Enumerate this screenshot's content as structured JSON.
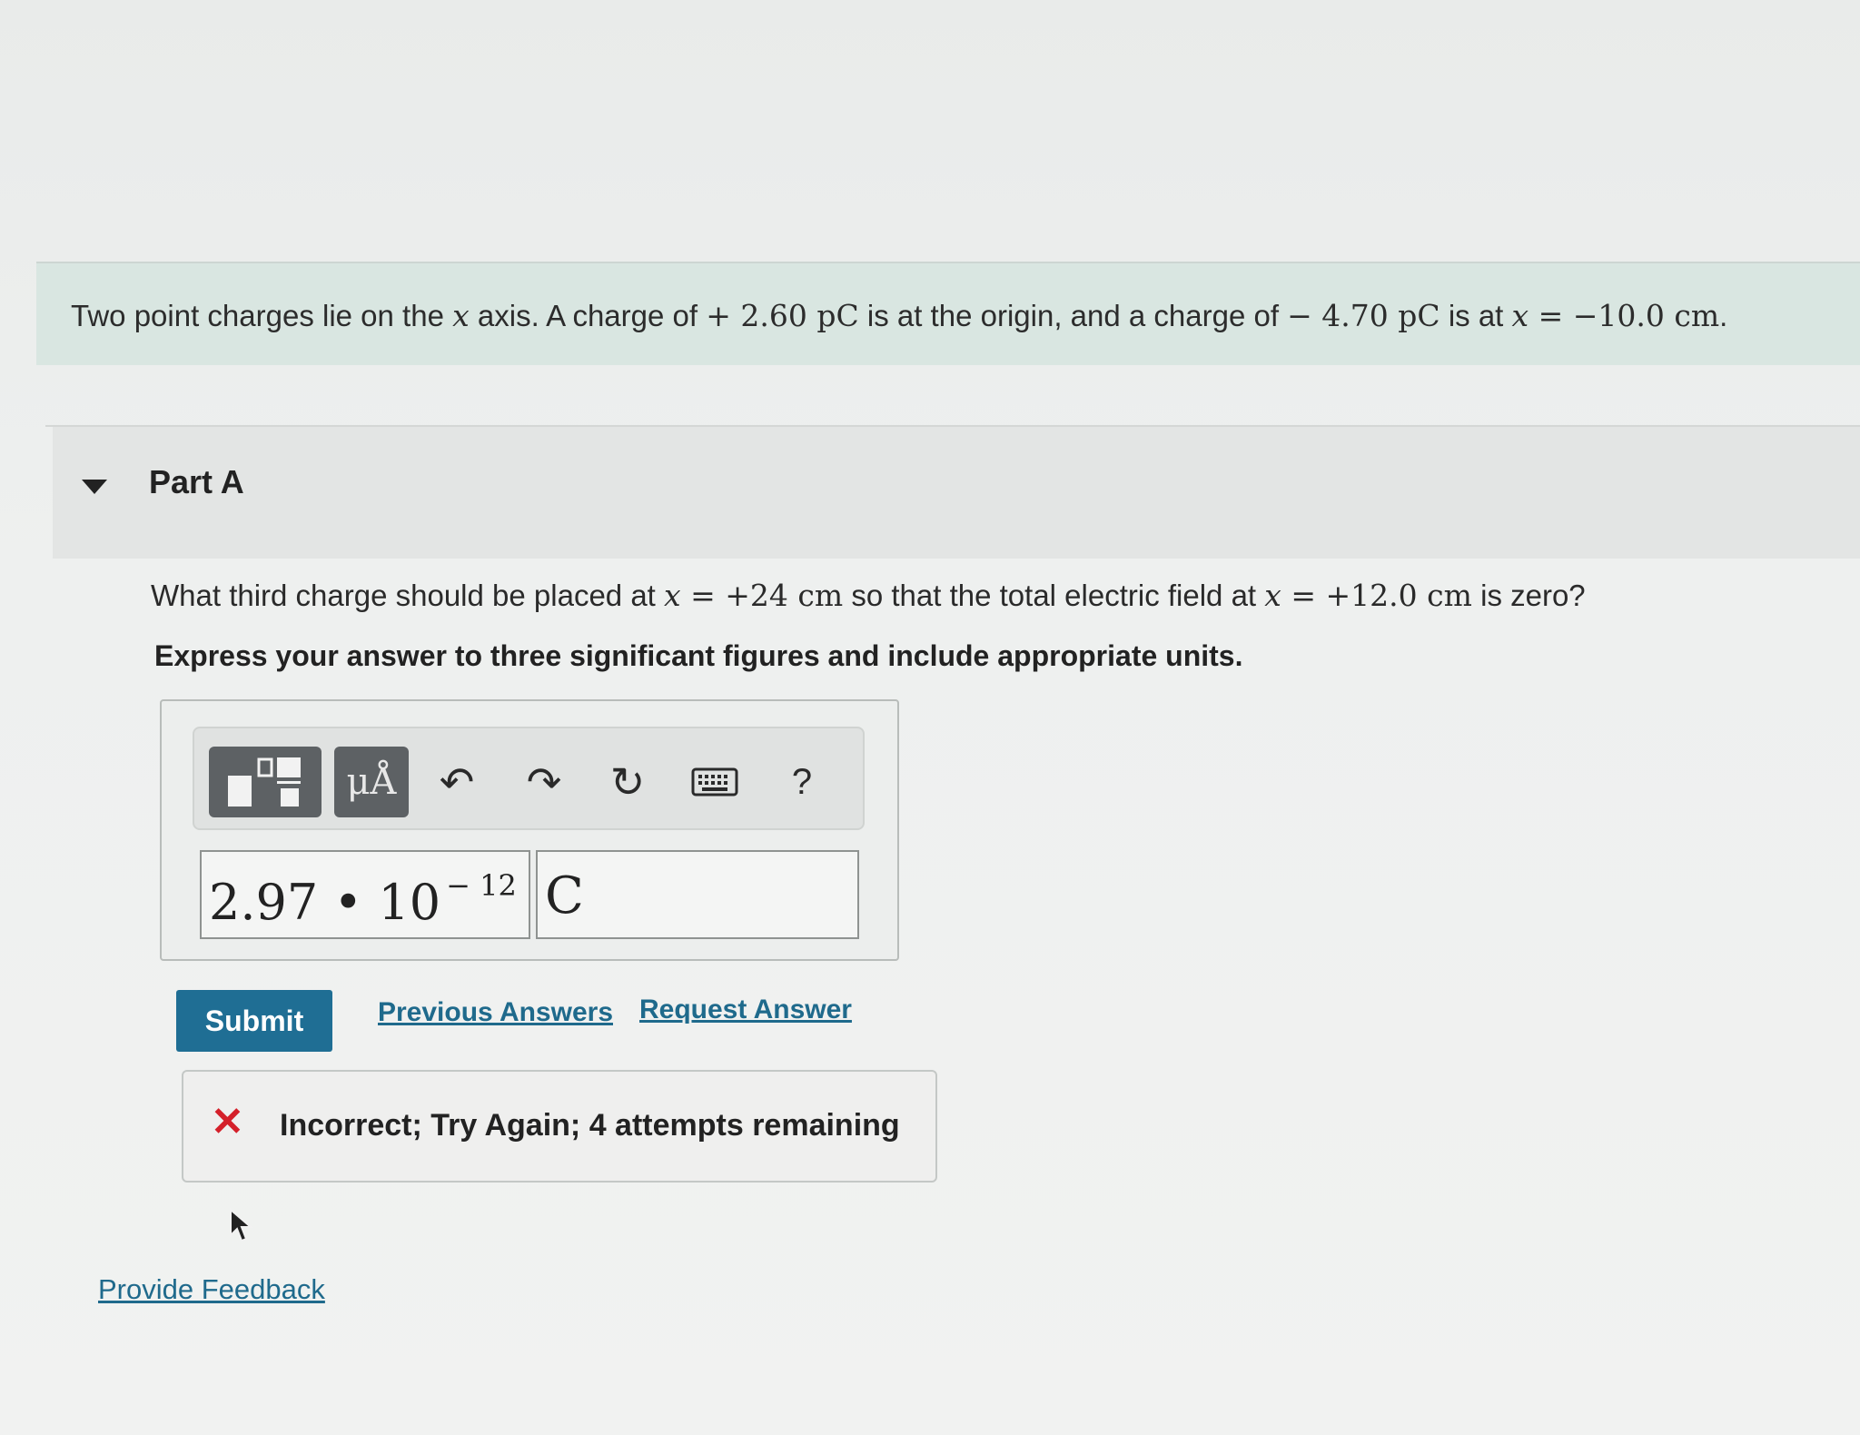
{
  "intro": {
    "t1": "Two point charges lie on the ",
    "var_x": "x",
    "t2": " axis. A charge of ",
    "q1": "+ 2.60 pC",
    "t3": " is at the origin, and a charge of ",
    "q2": "− 4.70 pC",
    "t4": " is at ",
    "pos": " = −10.0 cm",
    "t5": "."
  },
  "part": {
    "title": "Part A"
  },
  "question": {
    "t1": "What third charge should be placed at ",
    "var_x": "x",
    "pos1": " = +24 cm",
    "t2": " so that the total electric field at ",
    "pos2": " = +12.0 cm",
    "t3": " is zero?"
  },
  "instruction": "Express your answer to three significant figures and include appropriate units.",
  "toolbar": {
    "units_label": "μÅ",
    "undo_glyph": "↶",
    "redo_glyph": "↷",
    "reset_glyph": "↻",
    "help_label": "?"
  },
  "answer": {
    "value_mantissa": "2.97 • 10",
    "value_exponent": "− 12",
    "unit": "C"
  },
  "actions": {
    "submit_label": "Submit",
    "previous_answers": "Previous Answers",
    "request_answer": "Request Answer"
  },
  "feedback": {
    "icon": "✕",
    "message": "Incorrect; Try Again; 4 attempts remaining"
  },
  "footer": {
    "provide_feedback": "Provide Feedback"
  },
  "colors": {
    "accent": "#1f6e94",
    "link": "#1f6a8c",
    "error": "#d4202a",
    "intro_bg": "#d9e6e1"
  }
}
